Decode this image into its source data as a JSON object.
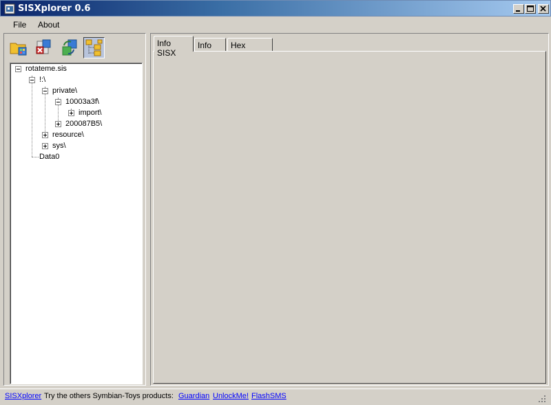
{
  "window": {
    "title": "SISXplorer 0.6",
    "icon": "sisxplorer-app-icon",
    "buttons": [
      "minimize-icon",
      "maximize-icon",
      "close-icon"
    ]
  },
  "menu": {
    "items": [
      {
        "label": "File"
      },
      {
        "label": "About"
      }
    ]
  },
  "toolbar": {
    "buttons": [
      {
        "icon": "open-folder-icon",
        "active": false
      },
      {
        "icon": "remove-icon",
        "active": false
      },
      {
        "icon": "refresh-icon",
        "active": false
      },
      {
        "icon": "tree-view-icon",
        "active": true
      }
    ]
  },
  "tree": {
    "nodes": [
      {
        "label": "rotateme.sis",
        "level": 0,
        "expander": "minus"
      },
      {
        "label": "!:\\",
        "level": 1,
        "expander": "minus"
      },
      {
        "label": "private\\",
        "level": 2,
        "expander": "minus"
      },
      {
        "label": "10003a3f\\",
        "level": 3,
        "expander": "minus"
      },
      {
        "label": "import\\",
        "level": 4,
        "expander": "plus"
      },
      {
        "label": "200087B5\\",
        "level": 3,
        "expander": "plus"
      },
      {
        "label": "resource\\",
        "level": 2,
        "expander": "plus"
      },
      {
        "label": "sys\\",
        "level": 2,
        "expander": "plus"
      },
      {
        "label": "Data0",
        "level": 1,
        "expander": "none"
      }
    ]
  },
  "tabs": [
    {
      "label": "Info SISX",
      "active": true
    },
    {
      "label": "Info File",
      "active": false
    },
    {
      "label": "Hex Viewer",
      "active": false
    }
  ],
  "status": {
    "app_link": "SISXplorer",
    "text": "Try the others Symbian-Toys products:",
    "links": [
      "Guardian",
      "UnlockMe!",
      "FlashSMS"
    ]
  },
  "colors": {
    "titlebar_start": "#0a246a",
    "titlebar_end": "#a6caf0",
    "face": "#d4d0c8",
    "link": "#0000ff"
  }
}
